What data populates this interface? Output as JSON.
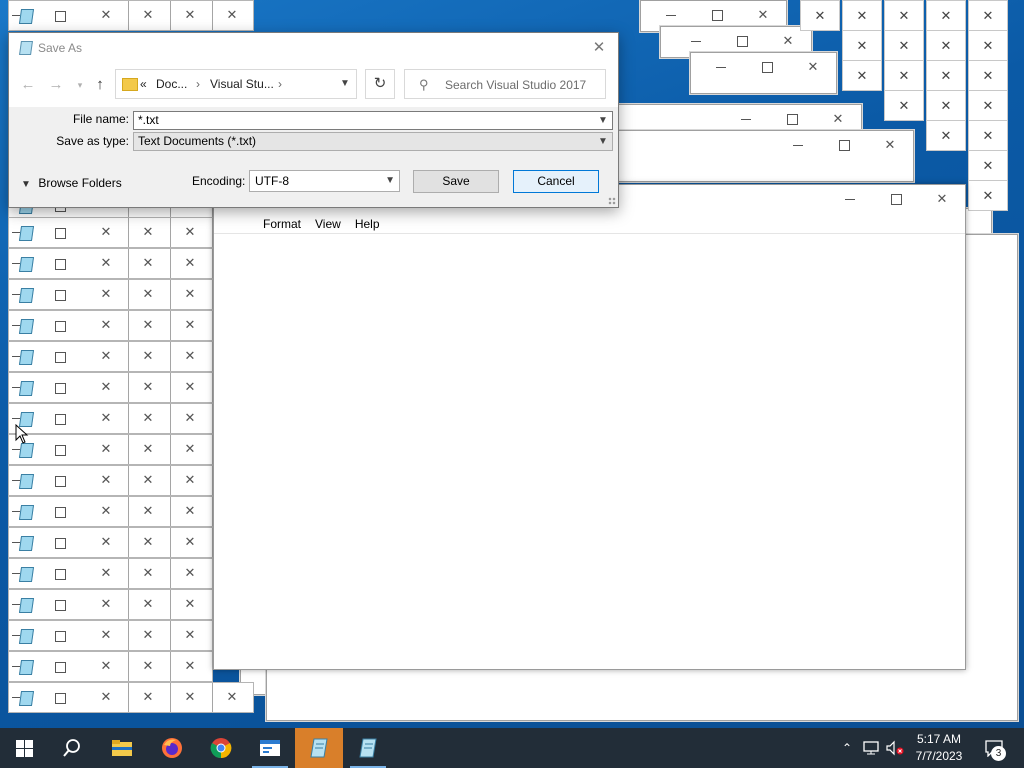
{
  "save_dialog": {
    "title": "Save As",
    "breadcrumb": [
      "«",
      "Doc...",
      "Visual Stu...",
      "›"
    ],
    "search_placeholder": "Search Visual Studio 2017",
    "file_name_label": "File name:",
    "file_name_value": "*.txt",
    "save_type_label": "Save as type:",
    "save_type_value": "Text Documents (*.txt)",
    "browse_folders_label": "Browse Folders",
    "encoding_label": "Encoding:",
    "encoding_value": "UTF-8",
    "save_label": "Save",
    "cancel_label": "Cancel"
  },
  "notepad": {
    "menu": [
      "Format",
      "View",
      "Help"
    ]
  },
  "taskbar": {
    "time": "5:17 AM",
    "date": "7/7/2023",
    "notification_count": "3",
    "items": [
      "start",
      "search",
      "file-explorer",
      "firefox",
      "chrome",
      "app",
      "notepad-active",
      "notepad"
    ]
  },
  "colors": {
    "accent": "#0078d7",
    "taskbar_active": "#d97f2a",
    "desktop": "#0b5aa6"
  }
}
